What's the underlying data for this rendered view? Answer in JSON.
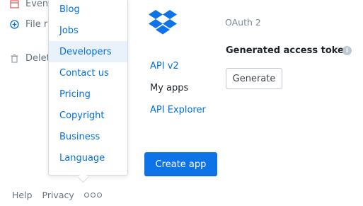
{
  "left_nav": {
    "items": [
      {
        "label": "Event",
        "icon": "calendar-icon"
      },
      {
        "label": "File r",
        "icon": "file-request-icon"
      },
      {
        "label": "Delet",
        "icon": "trash-icon"
      }
    ]
  },
  "dropdown_menu": {
    "items": [
      {
        "label": "Blog"
      },
      {
        "label": "Jobs"
      },
      {
        "label": "Developers",
        "active": true
      },
      {
        "label": "Contact us"
      },
      {
        "label": "Pricing"
      },
      {
        "label": "Copyright"
      },
      {
        "label": "Business"
      },
      {
        "label": "Language"
      }
    ]
  },
  "footer": {
    "help": "Help",
    "privacy": "Privacy",
    "more_icon": "more-dots-icon"
  },
  "developer_nav": {
    "logo_icon": "dropbox-logo-icon",
    "api_v2": "API v2",
    "my_apps": "My apps",
    "api_explorer": "API Explorer",
    "create_app": "Create app"
  },
  "oauth": {
    "label": "OAuth 2",
    "token_title": "Generated access token",
    "info_icon": "info-icon",
    "generate_label": "Generate"
  },
  "colors": {
    "accent": "#0d73e6",
    "link": "#0070e0",
    "active_bg": "#e9f2fb",
    "muted": "#637282"
  }
}
